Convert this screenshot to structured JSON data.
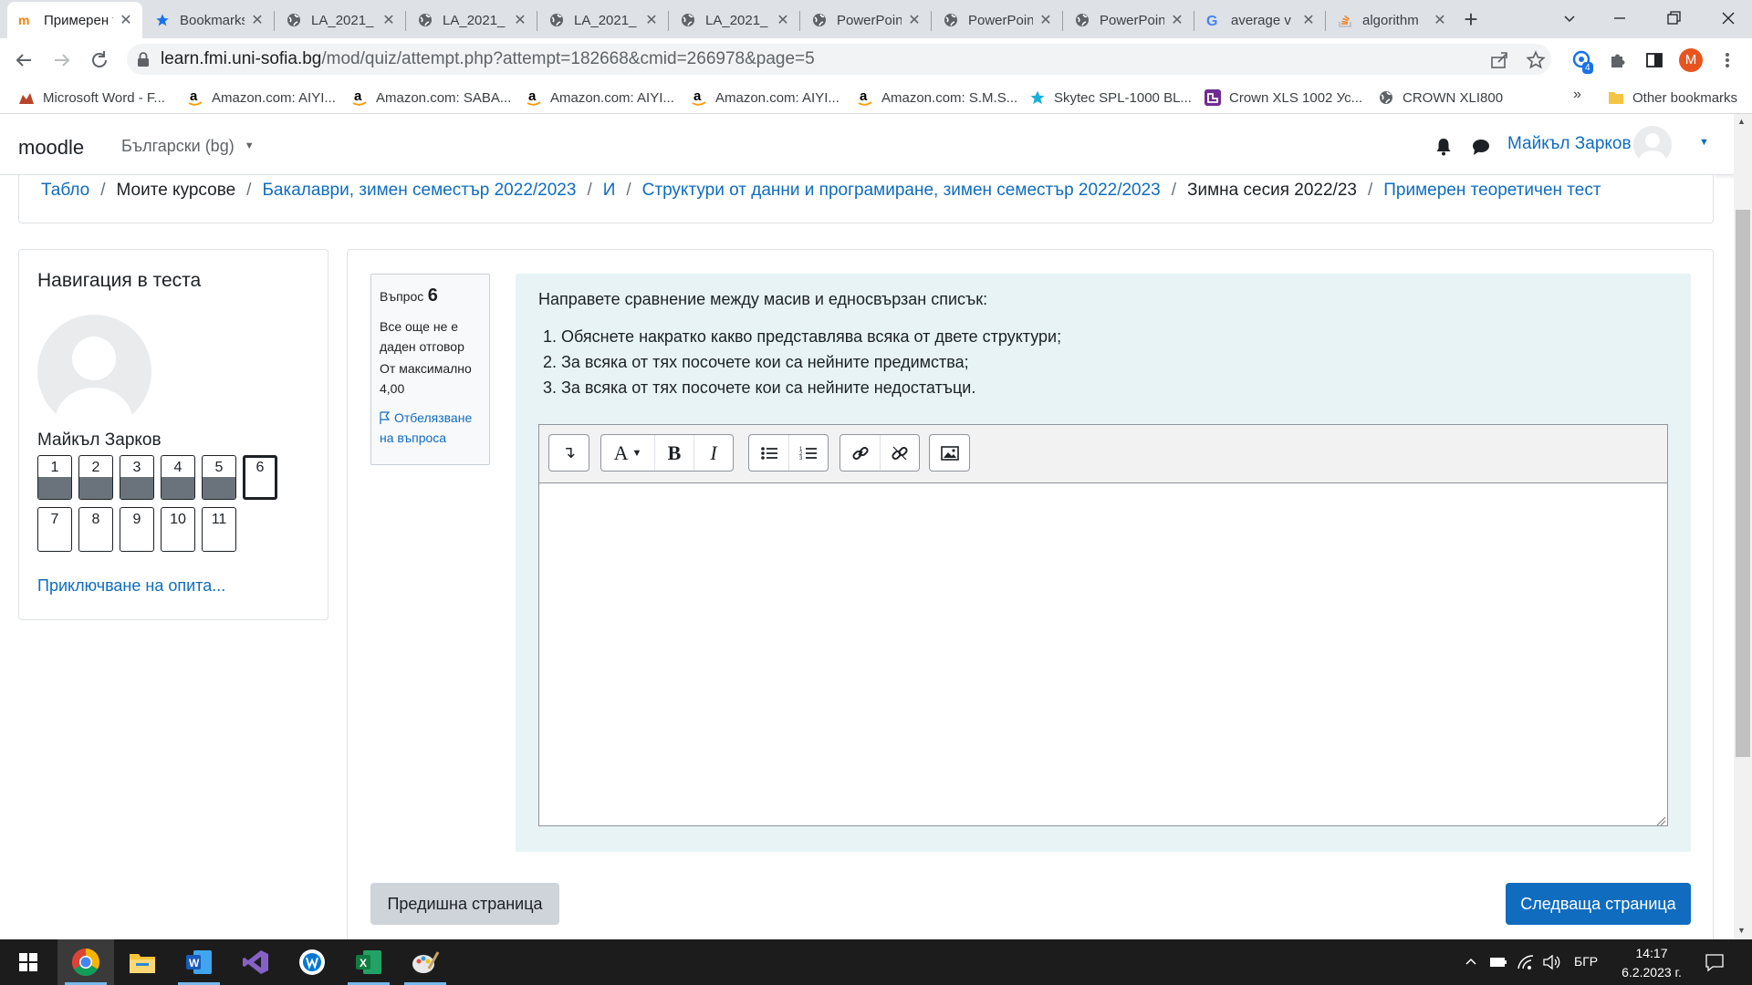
{
  "browser": {
    "tabs": [
      {
        "title": "Примерен теоретичен тест",
        "icon": "moodle-icon",
        "active": true
      },
      {
        "title": "Bookmarks",
        "icon": "star-icon"
      },
      {
        "title": "LA_2021_",
        "icon": "globe-icon"
      },
      {
        "title": "LA_2021_",
        "icon": "globe-icon"
      },
      {
        "title": "LA_2021_",
        "icon": "globe-icon"
      },
      {
        "title": "LA_2021_",
        "icon": "globe-icon"
      },
      {
        "title": "PowerPoint",
        "icon": "globe-icon"
      },
      {
        "title": "PowerPoint",
        "icon": "globe-icon"
      },
      {
        "title": "PowerPoint",
        "icon": "globe-icon"
      },
      {
        "title": "average v",
        "icon": "google-icon"
      },
      {
        "title": "algorithm",
        "icon": "stackoverflow-icon"
      }
    ],
    "new_tab": "+",
    "url_host": "learn.fmi.uni-sofia.bg",
    "url_path": "/mod/quiz/attempt.php?attempt=182668&cmid=266978&page=5",
    "profile_initial": "M",
    "ext_badge": "4",
    "bookmarks": [
      {
        "label": "Microsoft Word - F...",
        "icon": "word-bookmark-icon"
      },
      {
        "label": "Amazon.com: AIYI...",
        "icon": "amazon-icon"
      },
      {
        "label": "Amazon.com: SABA...",
        "icon": "amazon-icon"
      },
      {
        "label": "Amazon.com: AIYI...",
        "icon": "amazon-icon"
      },
      {
        "label": "Amazon.com: AIYI...",
        "icon": "amazon-icon"
      },
      {
        "label": "Amazon.com: S.M.S...",
        "icon": "amazon-icon"
      },
      {
        "label": "Skytec SPL-1000 BL...",
        "icon": "skytec-icon"
      },
      {
        "label": "Crown XLS 1002 Ус...",
        "icon": "crown-icon"
      },
      {
        "label": "CROWN XLI800",
        "icon": "globe-icon"
      }
    ],
    "bookmarks_more": "»",
    "other_bookmarks": "Other bookmarks"
  },
  "moodle": {
    "logo": "moodle",
    "language": "Български (bg)",
    "user_name": "Майкъл Зарков",
    "breadcrumb": [
      {
        "label": "Табло",
        "link": true
      },
      {
        "label": "Моите курсове",
        "link": false
      },
      {
        "label": "Бакалаври, зимен семестър 2022/2023",
        "link": true
      },
      {
        "label": "И",
        "link": true
      },
      {
        "label": "Структури от данни и програмиране, зимен семестър 2022/2023",
        "link": true
      },
      {
        "label": "Зимна сесия 2022/23",
        "link": false
      },
      {
        "label": "Примерен теоретичен тест",
        "link": true
      }
    ],
    "breadcrumb_sep": "/",
    "nav_block": {
      "title": "Навигация в теста",
      "user": "Майкъл Зарков",
      "questions": [
        {
          "n": "1",
          "answered": true
        },
        {
          "n": "2",
          "answered": true
        },
        {
          "n": "3",
          "answered": true
        },
        {
          "n": "4",
          "answered": true
        },
        {
          "n": "5",
          "answered": true
        },
        {
          "n": "6",
          "answered": false,
          "current": true
        },
        {
          "n": "7",
          "answered": false
        },
        {
          "n": "8",
          "answered": false
        },
        {
          "n": "9",
          "answered": false
        },
        {
          "n": "10",
          "answered": false
        },
        {
          "n": "11",
          "answered": false
        }
      ],
      "finish_link": "Приключване на опита..."
    },
    "question": {
      "label": "Въпрос",
      "number": "6",
      "status": "Все още не е даден отговор",
      "max_label": "От максимално",
      "max_value": "4,00",
      "flag": "Отбелязване на въпроса",
      "text": "Направете сравнение между масив и едносвързан списък:",
      "items": [
        "Обяснете накратко какво представлява всяка от двете структури;",
        "За всяка от тях посочете кои са нейните предимства;",
        "За всяка от тях посочете кои са нейните недостатъци."
      ],
      "answer_value": ""
    },
    "prev_button": "Предишна страница",
    "next_button": "Следваща страница"
  },
  "taskbar": {
    "language": "БГР",
    "time": "14:17",
    "date": "6.2.2023 г."
  },
  "colors": {
    "primary": "#0f6cbf",
    "question_bg": "#e7f3f5",
    "answered_fill": "#6a737b",
    "chrome_tabstrip": "#dee1e6",
    "profile": "#e8541f"
  }
}
